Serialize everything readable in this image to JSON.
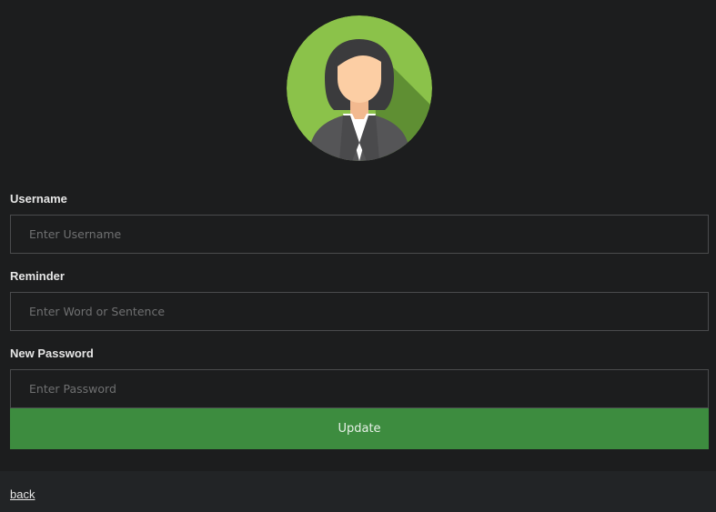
{
  "avatar": {
    "icon": "female-user-avatar-icon",
    "colors": {
      "circle": "#8bc24a",
      "shadow": "#5f8f33",
      "hair": "#3b3b3d",
      "skin": "#fccea4",
      "suit": "#555557",
      "shirt": "#ffffff"
    }
  },
  "form": {
    "username": {
      "label": "Username",
      "placeholder": "Enter Username",
      "value": ""
    },
    "reminder": {
      "label": "Reminder",
      "placeholder": "Enter Word or Sentence",
      "value": ""
    },
    "new_password": {
      "label": "New Password",
      "placeholder": "Enter Password",
      "value": ""
    },
    "submit_label": "Update"
  },
  "footer": {
    "back_label": "back"
  },
  "colors": {
    "background": "#1c1d1e",
    "footer_background": "#222426",
    "button": "#3d8c3f",
    "input_border": "#4a4b4d"
  }
}
